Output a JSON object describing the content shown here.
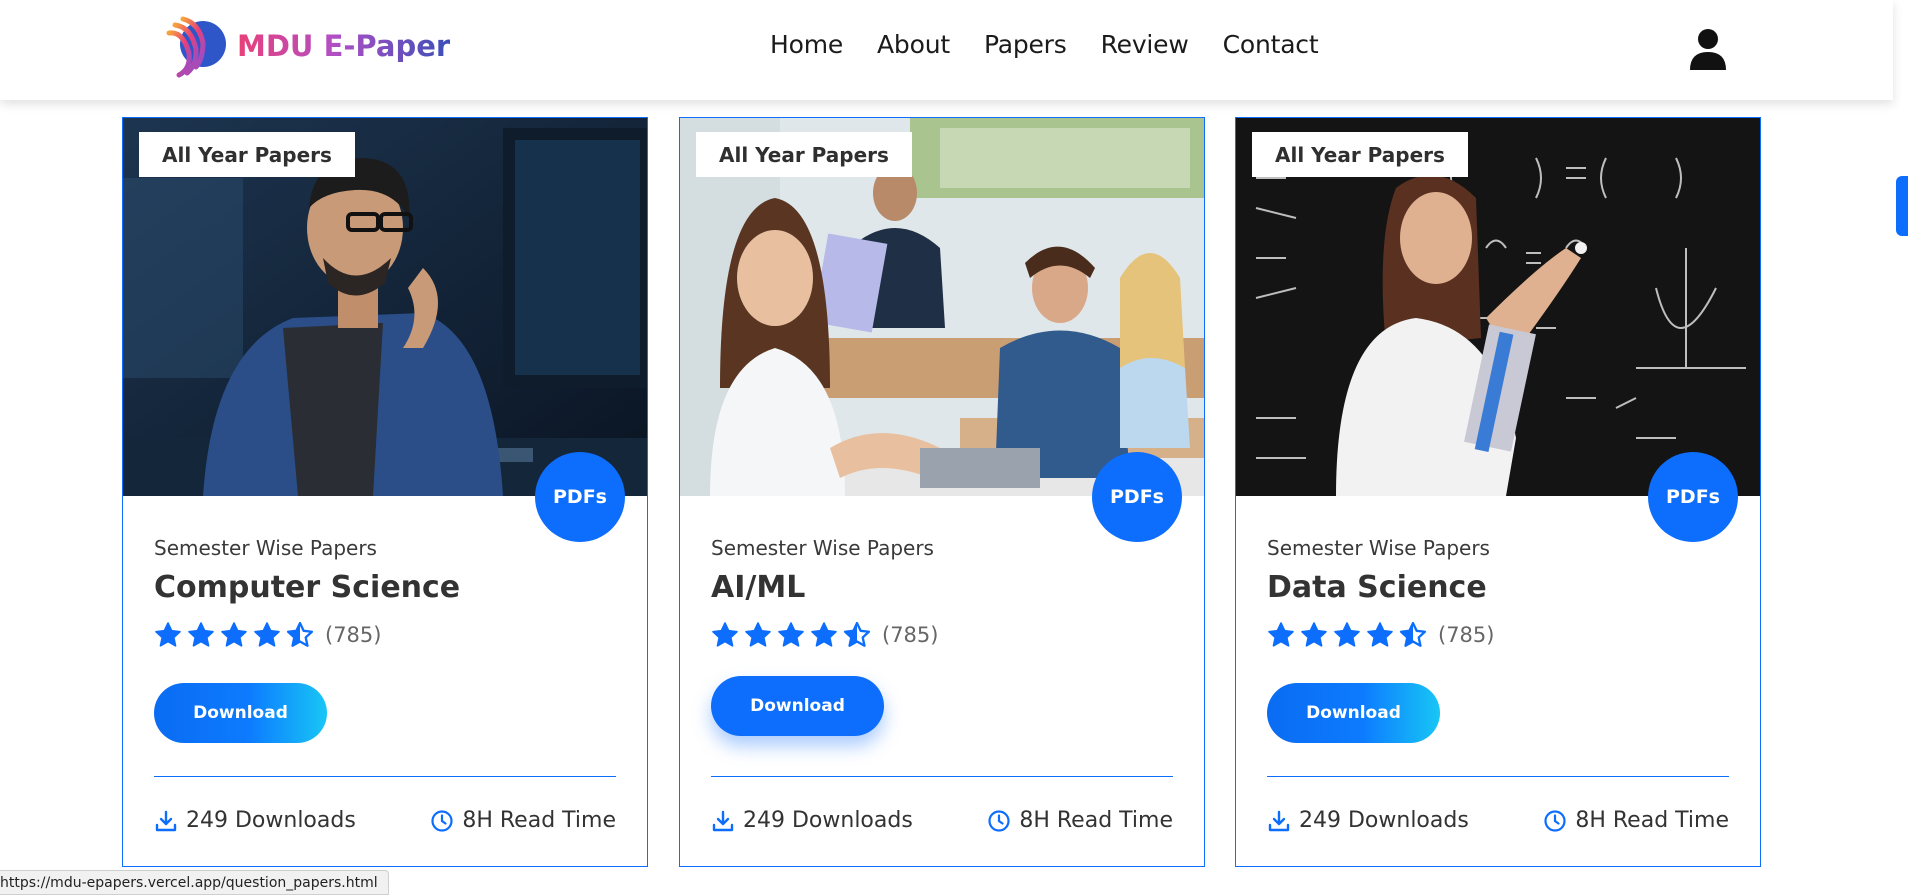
{
  "brand": {
    "name": "MDU E-Paper"
  },
  "nav": {
    "items": [
      "Home",
      "About",
      "Papers",
      "Review",
      "Contact"
    ]
  },
  "cards": [
    {
      "tag": "All Year Papers",
      "badge": "PDFs",
      "subtitle": "Semester Wise Papers",
      "title": "Computer Science",
      "rating": 4.5,
      "rating_count": "(785)",
      "button": "Download",
      "downloads": "249 Downloads",
      "read_time": "8H Read Time"
    },
    {
      "tag": "All Year Papers",
      "badge": "PDFs",
      "subtitle": "Semester Wise Papers",
      "title": "AI/ML",
      "rating": 4.5,
      "rating_count": "(785)",
      "button": "Download",
      "downloads": "249 Downloads",
      "read_time": "8H Read Time"
    },
    {
      "tag": "All Year Papers",
      "badge": "PDFs",
      "subtitle": "Semester Wise Papers",
      "title": "Data Science",
      "rating": 4.5,
      "rating_count": "(785)",
      "button": "Download",
      "downloads": "249 Downloads",
      "read_time": "8H Read Time"
    }
  ],
  "colors": {
    "accent": "#0d6efd",
    "border": "#0d6efd",
    "text": "#333333"
  },
  "icons": {
    "user": "user-icon",
    "download": "download-icon",
    "clock": "clock-icon",
    "star": "star-icon"
  },
  "status_bar": {
    "url": "https://mdu-epapers.vercel.app/question_papers.html"
  }
}
